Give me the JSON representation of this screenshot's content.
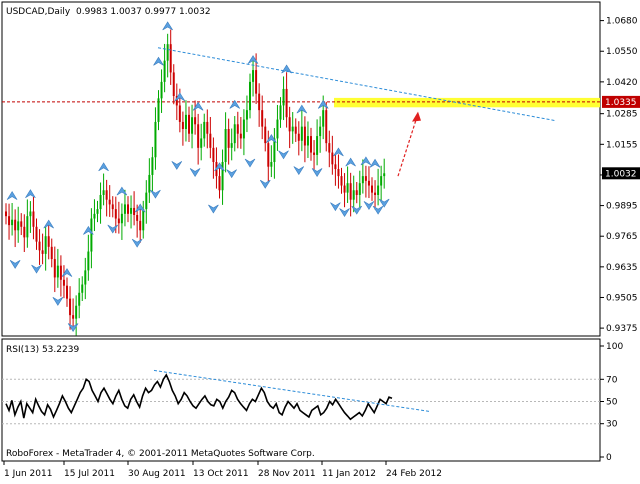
{
  "chart_data": [
    {
      "type": "candlestick",
      "title": "USDCAD,Daily",
      "ohlc_header": "0.9983 1.0037 0.9977 1.0032",
      "y_ticks": [
        "1.0680",
        "1.0550",
        "1.0420",
        "1.0285",
        "1.0155",
        "1.0025",
        "0.9895",
        "0.9765",
        "0.9635",
        "0.9505",
        "0.9375"
      ],
      "ylim": [
        0.935,
        1.0725
      ],
      "x_ticks": [
        "1 Jun 2011",
        "15 Jul 2011",
        "30 Aug 2011",
        "13 Oct 2011",
        "28 Nov 2011",
        "11 Jan 2012",
        "24 Feb 2012"
      ],
      "level": {
        "value": 1.0335,
        "label": "1.0335",
        "color": "#c00000"
      },
      "target_zone": {
        "from": 1.0312,
        "to": 1.0352,
        "color": "#ffff33"
      },
      "current_price": {
        "value": 1.0032,
        "label": "1.0032"
      },
      "bull_color": "#00aa00",
      "bear_color": "#cc0000",
      "fractal_color": "#5aa0e0",
      "trendline_color": "#2c8cd8",
      "arrow_color": "#e02020",
      "trendline": {
        "from": [
          0,
          1.0565
        ],
        "to": [
          130,
          1.0255
        ]
      },
      "forecast_arrow": {
        "from": [
          120,
          1.002
        ],
        "to": [
          128,
          1.0285
        ]
      },
      "closes": [
        0.985,
        0.9812,
        0.9835,
        0.979,
        0.9828,
        0.9805,
        0.976,
        0.985,
        0.987,
        0.9805,
        0.9742,
        0.9705,
        0.969,
        0.9765,
        0.972,
        0.9668,
        0.959,
        0.964,
        0.958,
        0.9555,
        0.95,
        0.943,
        0.9415,
        0.947,
        0.9525,
        0.956,
        0.962,
        0.97,
        0.984,
        0.986,
        0.988,
        0.994,
        0.996,
        0.992,
        0.99,
        0.988,
        0.984,
        0.982,
        0.986,
        0.99,
        0.986,
        0.9885,
        0.9855,
        0.983,
        0.979,
        0.988,
        0.995,
        1.0025,
        1.01,
        1.025,
        1.035,
        1.042,
        1.051,
        1.058,
        1.046,
        1.036,
        1.032,
        1.025,
        1.022,
        1.028,
        1.02,
        1.027,
        1.024,
        1.014,
        1.018,
        1.025,
        1.02,
        1.014,
        1.008,
        1.002,
        0.996,
        1.008,
        1.022,
        1.014,
        1.016,
        1.024,
        1.02,
        1.018,
        1.026,
        1.03,
        1.042,
        1.047,
        1.037,
        1.03,
        1.023,
        1.016,
        1.006,
        1.008,
        1.018,
        1.026,
        1.032,
        1.039,
        1.027,
        1.021,
        1.023,
        1.02,
        1.017,
        1.023,
        1.015,
        1.019,
        1.012,
        1.011,
        1.019,
        1.023,
        1.03,
        1.016,
        1.012,
        1.007,
        1.005,
        1.002,
        0.998,
        0.995,
        0.999,
        0.992,
        0.996,
        0.994,
        0.999,
        1.002,
        1.0,
        0.998,
        0.995,
        0.994,
        0.998,
        1.002,
        1.0032
      ],
      "arrows_down": [
        [
          2,
          0.9933
        ],
        [
          8,
          0.9941
        ],
        [
          14,
          0.9812
        ],
        [
          20,
          0.9606
        ],
        [
          27,
          0.9785
        ],
        [
          32,
          1.0055
        ],
        [
          38,
          0.9952
        ],
        [
          44,
          0.988
        ],
        [
          50,
          1.0503
        ],
        [
          53,
          1.0653
        ],
        [
          57,
          1.0352
        ],
        [
          63,
          1.0312
        ],
        [
          70,
          1.0055
        ],
        [
          75,
          1.032
        ],
        [
          81,
          1.051
        ],
        [
          87,
          1.0175
        ],
        [
          92,
          1.047
        ],
        [
          97,
          1.03
        ],
        [
          104,
          1.032
        ],
        [
          109,
          1.0118
        ],
        [
          113,
          1.0075
        ],
        [
          118,
          1.008
        ],
        [
          121,
          1.007
        ]
      ],
      "arrows_up": [
        [
          3,
          0.965
        ],
        [
          10,
          0.963
        ],
        [
          17,
          0.9493
        ],
        [
          22,
          0.9382
        ],
        [
          35,
          0.98
        ],
        [
          43,
          0.974
        ],
        [
          49,
          0.9948
        ],
        [
          56,
          1.007
        ],
        [
          62,
          1.004
        ],
        [
          68,
          0.9885
        ],
        [
          74,
          1.0035
        ],
        [
          80,
          1.008
        ],
        [
          85,
          0.999
        ],
        [
          91,
          1.0115
        ],
        [
          96,
          1.0048
        ],
        [
          102,
          1.004
        ],
        [
          108,
          0.9895
        ],
        [
          111,
          0.987
        ],
        [
          115,
          0.988
        ],
        [
          119,
          0.99
        ],
        [
          122,
          0.988
        ],
        [
          124,
          0.991
        ]
      ]
    },
    {
      "type": "line",
      "title": "RSI(13) 53.2239",
      "y_ticks": [
        "100",
        "70",
        "50",
        "30",
        "0"
      ],
      "ylim": [
        0,
        100
      ],
      "levels": [
        70,
        50,
        30
      ],
      "line_color": "#000000",
      "trendline": {
        "from": [
          55,
          78
        ],
        "to": [
          143,
          41
        ]
      },
      "values": [
        48,
        42,
        51,
        38,
        45,
        50,
        35,
        48,
        44,
        40,
        52,
        46,
        41,
        38,
        47,
        43,
        36,
        42,
        48,
        55,
        50,
        44,
        40,
        46,
        52,
        58,
        62,
        70,
        68,
        60,
        55,
        50,
        58,
        62,
        57,
        52,
        48,
        55,
        60,
        52,
        46,
        44,
        52,
        56,
        50,
        45,
        55,
        62,
        58,
        60,
        65,
        68,
        63,
        70,
        74,
        68,
        60,
        55,
        48,
        52,
        58,
        55,
        50,
        46,
        44,
        48,
        52,
        55,
        50,
        47,
        46,
        52,
        50,
        44,
        50,
        54,
        60,
        58,
        52,
        48,
        45,
        42,
        48,
        52,
        50,
        56,
        62,
        58,
        50,
        46,
        44,
        48,
        40,
        38,
        45,
        50,
        47,
        44,
        48,
        42,
        40,
        38,
        36,
        42,
        44,
        46,
        38,
        40,
        44,
        50,
        47,
        52,
        48,
        44,
        40,
        37,
        34,
        36,
        38,
        40,
        37,
        42,
        48,
        44,
        40,
        46,
        52,
        50,
        48,
        54,
        53
      ]
    }
  ],
  "footer": {
    "copyright": "RoboForex - MetaTrader 4, © 2001-2011 MetaQuotes Software Corp."
  }
}
